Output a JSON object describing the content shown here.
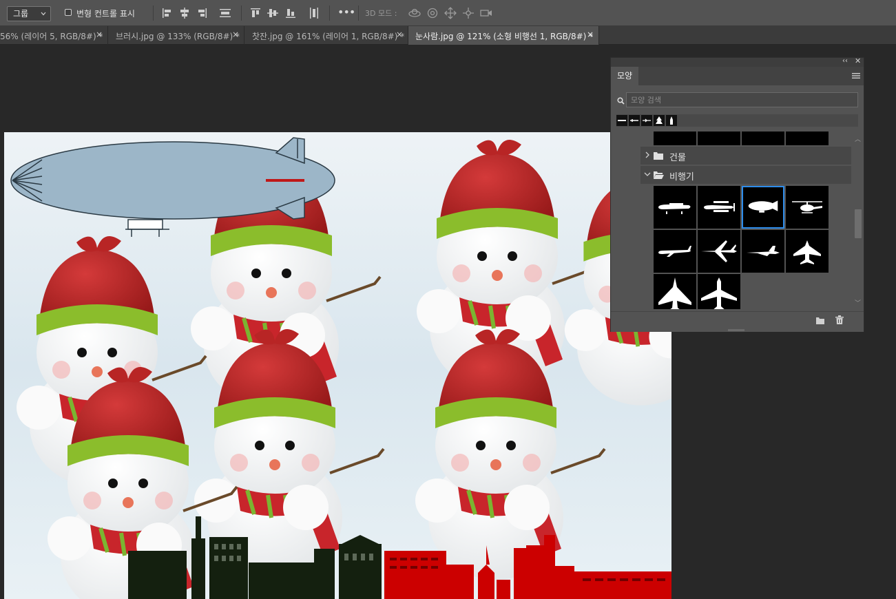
{
  "options_bar": {
    "group_select": "그룹",
    "transform_controls_label": "변형 컨트롤 표시",
    "mode_3d_label": "3D 모드 :"
  },
  "tabs": [
    {
      "label": "56% (레이어 5, RGB/8#) *",
      "active": false
    },
    {
      "label": "브러시.jpg @ 133% (RGB/8#) *",
      "active": false
    },
    {
      "label": "찻잔.jpg @ 161% (레이어 1, RGB/8#) *",
      "active": false
    },
    {
      "label": "눈사람.jpg @ 121% (소형 비행선 1, RGB/8#) *",
      "active": true
    }
  ],
  "tab_close": "×",
  "shapes_panel": {
    "tab_label": "모양",
    "search_placeholder": "모양 검색",
    "groups": [
      {
        "name": "건물",
        "expanded": false
      },
      {
        "name": "비행기",
        "expanded": true
      }
    ],
    "airplane_shapes": [
      {
        "name": "light-aircraft",
        "selected": false
      },
      {
        "name": "biplane",
        "selected": false
      },
      {
        "name": "blimp",
        "selected": true
      },
      {
        "name": "helicopter",
        "selected": false
      },
      {
        "name": "jet-airliner",
        "selected": false
      },
      {
        "name": "fighter-jet",
        "selected": false
      },
      {
        "name": "stealth-jet",
        "selected": false
      },
      {
        "name": "fighter-topview",
        "selected": false
      },
      {
        "name": "delta-jet-topview",
        "selected": false
      },
      {
        "name": "airliner-topview",
        "selected": false
      }
    ]
  },
  "colors": {
    "selection_accent": "#2d8ceb",
    "blimp_body": "#9cb6c8",
    "skyline_dark": "#14200f",
    "skyline_red": "#cc0000"
  }
}
